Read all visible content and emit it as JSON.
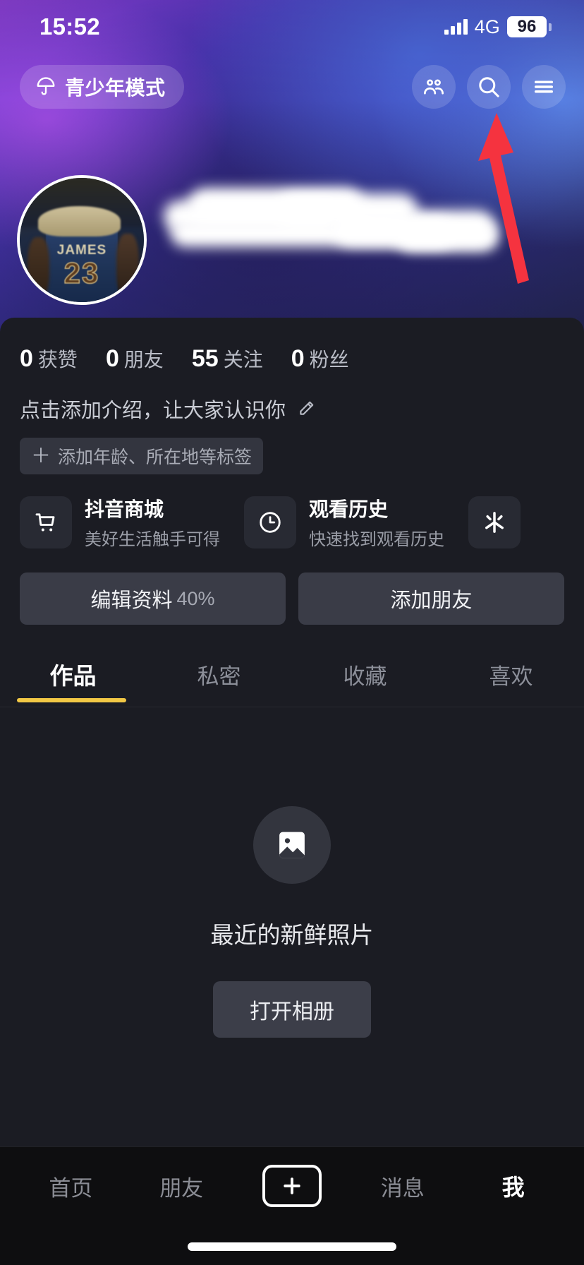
{
  "status_bar": {
    "time": "15:52",
    "network": "4G",
    "battery_level": "96",
    "signal_icon": "signal-bars-icon",
    "battery_icon": "battery-icon"
  },
  "top_bar": {
    "teen_mode": {
      "label": "青少年模式",
      "icon": "umbrella-icon"
    },
    "actions": [
      {
        "name": "friends-icon",
        "icon": "people-icon"
      },
      {
        "name": "search-icon",
        "icon": "magnifier-icon"
      },
      {
        "name": "menu-icon",
        "icon": "hamburger-icon"
      }
    ]
  },
  "profile": {
    "avatar": {
      "icon": "user-avatar",
      "jersey_name": "JAMES",
      "jersey_number": "23"
    },
    "username_hidden": true,
    "stats": [
      {
        "value": "0",
        "label": "获赞"
      },
      {
        "value": "0",
        "label": "朋友"
      },
      {
        "value": "55",
        "label": "关注"
      },
      {
        "value": "0",
        "label": "粉丝"
      }
    ],
    "bio_placeholder": "点击添加介绍，让大家认识你",
    "bio_edit_icon": "pencil-icon",
    "tag_chip": {
      "plus": "＋",
      "label": "添加年龄、所在地等标签"
    }
  },
  "shortcut_cards": [
    {
      "title": "抖音商城",
      "subtitle": "美好生活触手可得",
      "icon": "shopping-cart-icon"
    },
    {
      "title": "观看历史",
      "subtitle": "快速找到观看历史",
      "icon": "clock-icon"
    },
    {
      "title": "",
      "subtitle": "",
      "icon": "douyin-star-icon"
    }
  ],
  "action_buttons": [
    {
      "label": "编辑资料",
      "suffix": "40%",
      "name": "edit-profile-button"
    },
    {
      "label": "添加朋友",
      "suffix": "",
      "name": "add-friend-button"
    }
  ],
  "tabs": [
    {
      "label": "作品",
      "active": true
    },
    {
      "label": "私密",
      "active": false
    },
    {
      "label": "收藏",
      "active": false
    },
    {
      "label": "喜欢",
      "active": false
    }
  ],
  "empty_state": {
    "icon": "image-placeholder-icon",
    "title": "最近的新鲜照片",
    "button_label": "打开相册"
  },
  "bottom_nav": [
    {
      "label": "首页",
      "active": false,
      "name": "nav-home"
    },
    {
      "label": "朋友",
      "active": false,
      "name": "nav-friends"
    },
    {
      "label": "+",
      "active": false,
      "name": "nav-create"
    },
    {
      "label": "消息",
      "active": false,
      "name": "nav-messages"
    },
    {
      "label": "我",
      "active": true,
      "name": "nav-me"
    }
  ],
  "annotation": {
    "arrow_color": "#f5333f",
    "points_to": "menu-icon"
  },
  "colors": {
    "accent_yellow": "#f2c845",
    "sheet_bg": "#1b1c23",
    "card_bg": "#282a33",
    "button_bg": "#3a3c47",
    "nav_bg": "#0e0e10"
  }
}
